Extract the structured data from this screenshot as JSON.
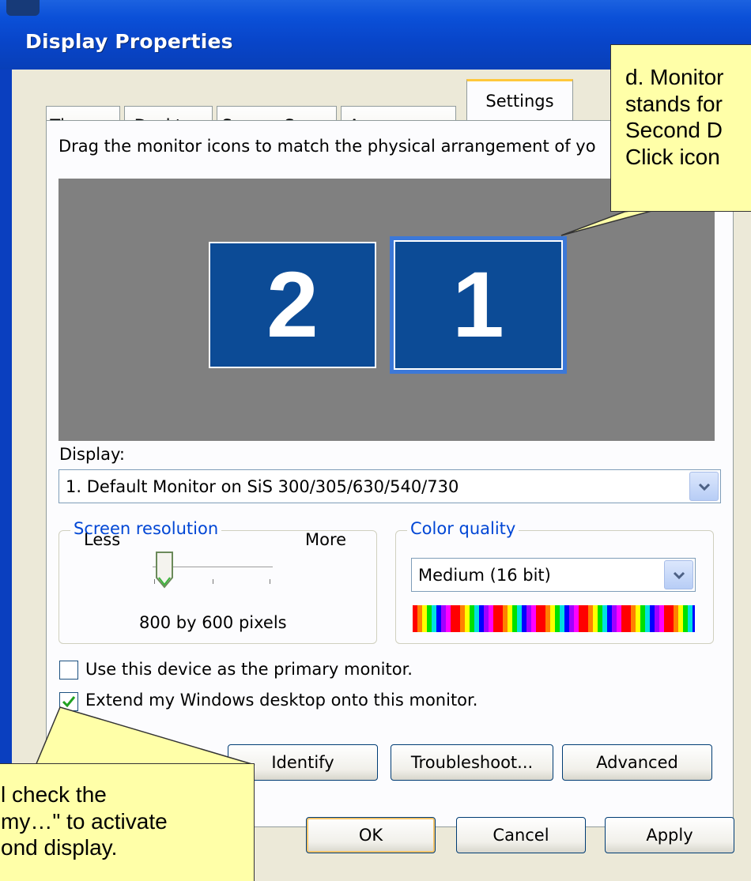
{
  "window": {
    "title": "Display Properties"
  },
  "tabs": [
    {
      "label": "Themes"
    },
    {
      "label": "Desktop"
    },
    {
      "label": "Screen Saver"
    },
    {
      "label": "Appearance"
    },
    {
      "label": "Settings",
      "active": true
    }
  ],
  "settings": {
    "instruction": "Drag the monitor icons to match the physical arrangement of yo",
    "monitors": [
      {
        "number": "2",
        "selected": false
      },
      {
        "number": "1",
        "selected": true
      }
    ],
    "display_label": "Display:",
    "display_value": "1. Default Monitor on SiS 300/305/630/540/730",
    "resolution": {
      "legend": "Screen resolution",
      "less_label": "Less",
      "more_label": "More",
      "value_text": "800 by 600 pixels",
      "slider_level": 0.08
    },
    "color": {
      "legend": "Color quality",
      "value": "Medium (16 bit)"
    },
    "checkboxes": [
      {
        "label": "Use this device as the primary monitor.",
        "checked": false
      },
      {
        "label": "Extend my Windows desktop onto this monitor.",
        "checked": true
      }
    ],
    "buttons": {
      "identify": "Identify",
      "troubleshoot": "Troubleshoot...",
      "advanced": "Advanced"
    }
  },
  "dialog_buttons": {
    "ok": "OK",
    "cancel": "Cancel",
    "apply": "Apply"
  },
  "callouts": {
    "top_right": [
      "d. Monitor",
      "stands for",
      "Second D",
      "Click icon"
    ],
    "bottom_left": [
      "l check the",
      "my…\" to activate",
      "ond display."
    ]
  },
  "colors": {
    "title_bar": "#0845c9",
    "dialog_bg": "#ece9d8",
    "monitor_fill": "#0c4b96",
    "monitor_area": "#808080",
    "group_legend": "#0046d5",
    "callout_bg": "#ffffa8",
    "active_tab_accent": "#ffc83c"
  },
  "icons": {
    "dropdown": "chevron-down-icon",
    "checkmark": "checkmark-icon",
    "slider": "slider-thumb-icon"
  }
}
